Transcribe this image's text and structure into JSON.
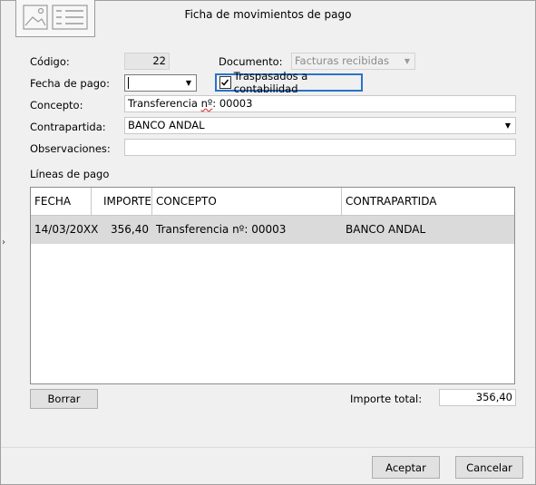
{
  "window": {
    "title": "Ficha de movimientos de pago"
  },
  "form": {
    "codigo_label": "Código:",
    "codigo_value": "22",
    "documento_label": "Documento:",
    "documento_value": "Facturas recibidas",
    "fecha_label": "Fecha de pago:",
    "fecha_value": "",
    "traspasados_label": "Traspasados a contabilidad",
    "traspasados_checked": true,
    "concepto_label": "Concepto:",
    "concepto_value_pre": "Transferencia ",
    "concepto_value_n": "nº",
    "concepto_value_post": ": 00003",
    "contrapartida_label": "Contrapartida:",
    "contrapartida_value": "BANCO ANDAL",
    "observaciones_label": "Observaciones:",
    "observaciones_value": ""
  },
  "lines": {
    "section_label": "Líneas de pago",
    "columns": [
      "FECHA",
      "IMPORTE",
      "CONCEPTO",
      "CONTRAPARTIDA"
    ],
    "rows": [
      {
        "fecha": "14/03/20XX",
        "importe": "356,40",
        "concepto": "Transferencia nº: 00003",
        "contrapartida": "BANCO ANDAL"
      }
    ]
  },
  "footer": {
    "borrar_label": "Borrar",
    "importe_total_label": "Importe total:",
    "importe_total_value": "356,40",
    "aceptar_label": "Aceptar",
    "cancelar_label": "Cancelar"
  },
  "icons": {
    "logo": "image-placeholder-icon",
    "dropdown": "triangle-down-icon",
    "row_indicator": "chevron-right-icon"
  }
}
